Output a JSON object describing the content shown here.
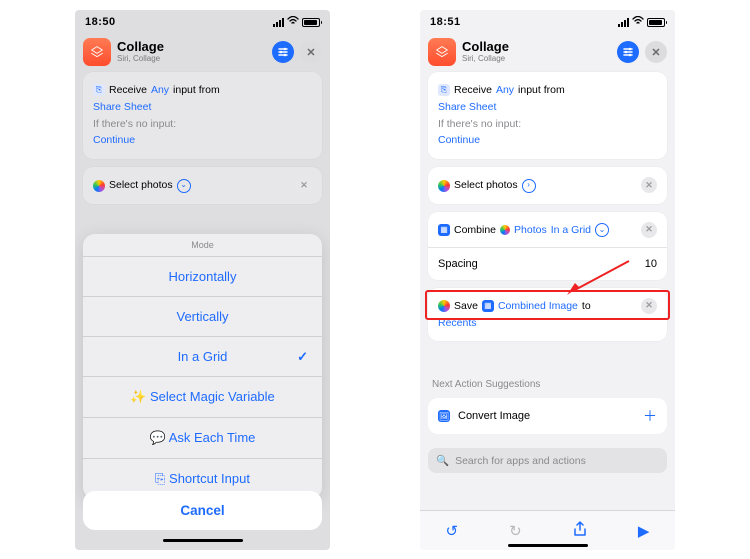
{
  "left": {
    "status": {
      "time": "18:50"
    },
    "header": {
      "title": "Collage",
      "subtitle": "Siri, Collage"
    },
    "receive": {
      "prefix": "Receive",
      "any": "Any",
      "suffix": "input from",
      "share_sheet": "Share Sheet",
      "no_input": "If there's no input:",
      "continue": "Continue"
    },
    "select_photos": "Select photos",
    "sheet": {
      "title": "Mode",
      "items": [
        "Horizontally",
        "Vertically",
        "In a Grid",
        "Select Magic Variable",
        "Ask Each Time",
        "Shortcut Input"
      ],
      "selected_index": 2,
      "cancel": "Cancel"
    }
  },
  "right": {
    "status": {
      "time": "18:51"
    },
    "header": {
      "title": "Collage",
      "subtitle": "Siri, Collage"
    },
    "receive": {
      "prefix": "Receive",
      "any": "Any",
      "suffix": "input from",
      "share_sheet": "Share Sheet",
      "no_input": "If there's no input:",
      "continue": "Continue"
    },
    "select_photos": "Select photos",
    "combine": {
      "verb": "Combine",
      "photos": "Photos",
      "mode": "In a Grid",
      "spacing_label": "Spacing",
      "spacing_value": "10"
    },
    "save": {
      "verb": "Save",
      "image": "Combined Image",
      "to": "to",
      "album": "Recents"
    },
    "suggestions": {
      "title": "Next Action Suggestions",
      "item": "Convert Image"
    },
    "search_placeholder": "Search for apps and actions"
  }
}
